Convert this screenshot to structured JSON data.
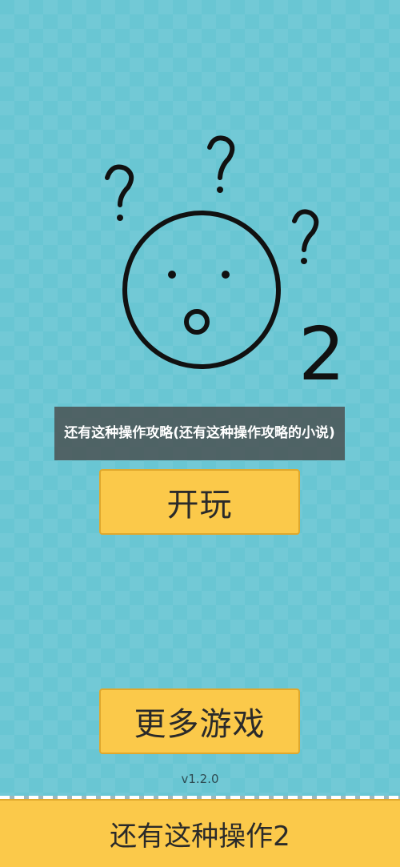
{
  "logo": {
    "subtitle_number": "2"
  },
  "caption": {
    "text": "还有这种操作攻略(还有这种操作攻略的小说)"
  },
  "buttons": {
    "play_label": "开玩",
    "more_games_label": "更多游戏"
  },
  "version": "v1.2.0",
  "banner": {
    "text": "还有这种操作2"
  },
  "colors": {
    "background": "#69c6d3",
    "button": "#fbc94a",
    "caption_bg": "#464646"
  }
}
